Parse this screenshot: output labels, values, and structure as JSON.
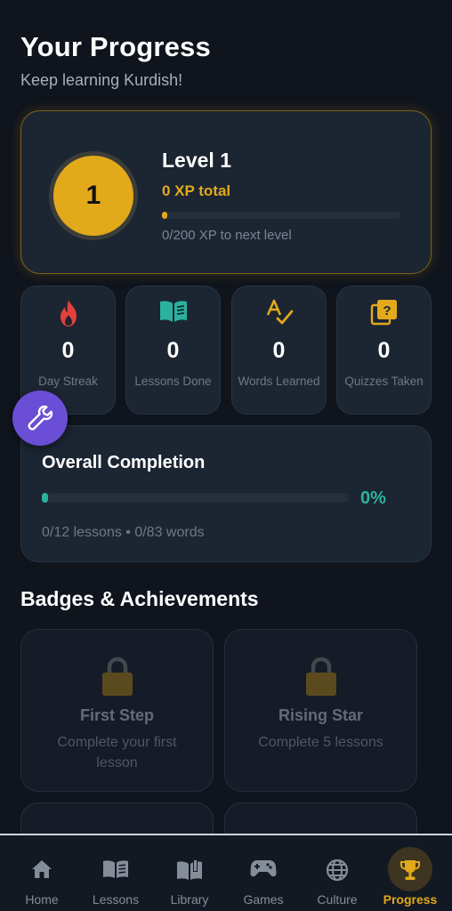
{
  "header": {
    "title": "Your Progress",
    "subtitle": "Keep learning Kurdish!"
  },
  "level": {
    "badge_number": "1",
    "title": "Level 1",
    "xp_total": "0 XP total",
    "next_level_text": "0/200 XP to next level",
    "progress_fraction": 0.0
  },
  "stats": [
    {
      "icon": "fire-icon",
      "value": "0",
      "label": "Day Streak"
    },
    {
      "icon": "open-book-icon",
      "value": "0",
      "label": "Lessons Done"
    },
    {
      "icon": "spell-check-icon",
      "value": "0",
      "label": "Words Learned"
    },
    {
      "icon": "quiz-icon",
      "value": "0",
      "label": "Quizzes Taken"
    }
  ],
  "tools_button": {
    "icon": "wrench-icon"
  },
  "completion": {
    "title": "Overall Completion",
    "percent_text": "0%",
    "progress_fraction": 0.0,
    "summary": "0/12 lessons • 0/83 words"
  },
  "badges_section": {
    "title": "Badges & Achievements",
    "badges": [
      {
        "icon": "lock-icon",
        "name": "First Step",
        "description": "Complete your first lesson",
        "locked": true
      },
      {
        "icon": "lock-icon",
        "name": "Rising Star",
        "description": "Complete 5 lessons",
        "locked": true
      }
    ]
  },
  "nav": {
    "items": [
      {
        "icon": "home-icon",
        "label": "Home",
        "active": false
      },
      {
        "icon": "book-icon",
        "label": "Lessons",
        "active": false
      },
      {
        "icon": "library-icon",
        "label": "Library",
        "active": false
      },
      {
        "icon": "gamepad-icon",
        "label": "Games",
        "active": false
      },
      {
        "icon": "globe-icon",
        "label": "Culture",
        "active": false
      },
      {
        "icon": "trophy-icon",
        "label": "Progress",
        "active": true
      }
    ]
  },
  "colors": {
    "background": "#0f141d",
    "card": "#1c2532",
    "gold_accent": "#e2a91a",
    "teal_accent": "#2bb29e",
    "tools_purple": "#6a4ed6"
  }
}
